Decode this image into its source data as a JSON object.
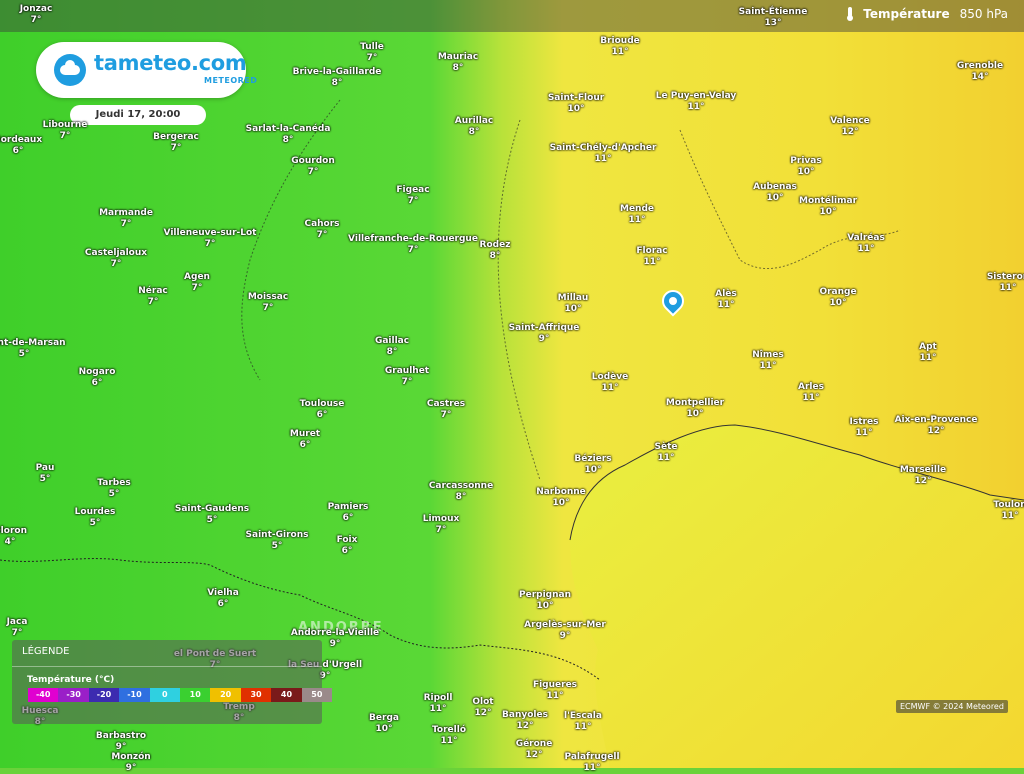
{
  "header": {
    "layer_name": "Température",
    "layer_level": "850 hPa",
    "thermometer_icon": "thermometer-icon"
  },
  "logo": {
    "name": "tameteo.com",
    "subname": "METEORED",
    "icon": "cloud-logo-icon"
  },
  "date_label": "Jeudi 17, 20:00",
  "regions": [
    "ANDORRE"
  ],
  "cities": [
    {
      "name": "Jonzac",
      "temp": "7°"
    },
    {
      "name": "Saint-Étienne",
      "temp": "13°"
    },
    {
      "name": "Brioude",
      "temp": "11°"
    },
    {
      "name": "Tulle",
      "temp": "7°"
    },
    {
      "name": "Mauriac",
      "temp": "8°"
    },
    {
      "name": "Brive-la-Gaillarde",
      "temp": "8°"
    },
    {
      "name": "Grenoble",
      "temp": "14°"
    },
    {
      "name": "Saint-Flour",
      "temp": "10°"
    },
    {
      "name": "Le Puy-en-Velay",
      "temp": "11°"
    },
    {
      "name": "Libourne",
      "temp": "7°"
    },
    {
      "name": "Bordeaux",
      "temp": "6°"
    },
    {
      "name": "Bergerac",
      "temp": "7°"
    },
    {
      "name": "Sarlat-la-Canéda",
      "temp": "8°"
    },
    {
      "name": "Aurillac",
      "temp": "8°"
    },
    {
      "name": "Valence",
      "temp": "12°"
    },
    {
      "name": "Saint-Chély-d'Apcher",
      "temp": "11°"
    },
    {
      "name": "Gourdon",
      "temp": "7°"
    },
    {
      "name": "Privas",
      "temp": "10°"
    },
    {
      "name": "Figeac",
      "temp": "7°"
    },
    {
      "name": "Aubenas",
      "temp": "10°"
    },
    {
      "name": "Montélimar",
      "temp": "10°"
    },
    {
      "name": "Marmande",
      "temp": "7°"
    },
    {
      "name": "Mende",
      "temp": "11°"
    },
    {
      "name": "Cahors",
      "temp": "7°"
    },
    {
      "name": "Villeneuve-sur-Lot",
      "temp": "7°"
    },
    {
      "name": "Villefranche-de-Rouergue",
      "temp": "7°"
    },
    {
      "name": "Rodez",
      "temp": "8°"
    },
    {
      "name": "Valréas",
      "temp": "11°"
    },
    {
      "name": "Casteljaloux",
      "temp": "7°"
    },
    {
      "name": "Florac",
      "temp": "11°"
    },
    {
      "name": "Agen",
      "temp": "7°"
    },
    {
      "name": "Sisteron",
      "temp": "11°"
    },
    {
      "name": "Nérac",
      "temp": "7°"
    },
    {
      "name": "Moissac",
      "temp": "7°"
    },
    {
      "name": "Millau",
      "temp": "10°"
    },
    {
      "name": "Alès",
      "temp": "11°"
    },
    {
      "name": "Orange",
      "temp": "10°"
    },
    {
      "name": "Mont-de-Marsan",
      "temp": "5°"
    },
    {
      "name": "Saint-Affrique",
      "temp": "9°"
    },
    {
      "name": "Gaillac",
      "temp": "8°"
    },
    {
      "name": "Apt",
      "temp": "11°"
    },
    {
      "name": "Nogaro",
      "temp": "6°"
    },
    {
      "name": "Graulhet",
      "temp": "7°"
    },
    {
      "name": "Nîmes",
      "temp": "11°"
    },
    {
      "name": "Lodève",
      "temp": "11°"
    },
    {
      "name": "Arles",
      "temp": "11°"
    },
    {
      "name": "Toulouse",
      "temp": "6°"
    },
    {
      "name": "Castres",
      "temp": "7°"
    },
    {
      "name": "Montpellier",
      "temp": "10°"
    },
    {
      "name": "Istres",
      "temp": "11°"
    },
    {
      "name": "Aix-en-Provence",
      "temp": "12°"
    },
    {
      "name": "Muret",
      "temp": "6°"
    },
    {
      "name": "Sète",
      "temp": "11°"
    },
    {
      "name": "Béziers",
      "temp": "10°"
    },
    {
      "name": "Pau",
      "temp": "5°"
    },
    {
      "name": "Marseille",
      "temp": "12°"
    },
    {
      "name": "Tarbes",
      "temp": "5°"
    },
    {
      "name": "Carcassonne",
      "temp": "8°"
    },
    {
      "name": "Narbonne",
      "temp": "10°"
    },
    {
      "name": "Pamiers",
      "temp": "6°"
    },
    {
      "name": "Lourdes",
      "temp": "5°"
    },
    {
      "name": "Saint-Gaudens",
      "temp": "5°"
    },
    {
      "name": "Limoux",
      "temp": "7°"
    },
    {
      "name": "Toulon",
      "temp": "11°"
    },
    {
      "name": "Oloron",
      "temp": "4°"
    },
    {
      "name": "Saint-Girons",
      "temp": "5°"
    },
    {
      "name": "Foix",
      "temp": "6°"
    },
    {
      "name": "Perpignan",
      "temp": "10°"
    },
    {
      "name": "Vielha",
      "temp": "6°"
    },
    {
      "name": "Jaca",
      "temp": "7°"
    },
    {
      "name": "Andorre-la-Vieille",
      "temp": "9°"
    },
    {
      "name": "Argelès-sur-Mer",
      "temp": "9°"
    },
    {
      "name": "el Pont de Suert",
      "temp": "7°"
    },
    {
      "name": "la Seu d'Urgell",
      "temp": "9°"
    },
    {
      "name": "Figueres",
      "temp": "11°"
    },
    {
      "name": "Huesca",
      "temp": "8°"
    },
    {
      "name": "Tremp",
      "temp": "8°"
    },
    {
      "name": "Ripoll",
      "temp": "11°"
    },
    {
      "name": "Olot",
      "temp": "12°"
    },
    {
      "name": "Berga",
      "temp": "10°"
    },
    {
      "name": "Banyoles",
      "temp": "12°"
    },
    {
      "name": "l'Escala",
      "temp": "11°"
    },
    {
      "name": "Barbastro",
      "temp": "9°"
    },
    {
      "name": "Torelló",
      "temp": "11°"
    },
    {
      "name": "Gérone",
      "temp": "12°"
    },
    {
      "name": "Monzón",
      "temp": "9°"
    },
    {
      "name": "Palafrugell",
      "temp": "11°"
    }
  ],
  "legend": {
    "title": "LÉGENDE",
    "subtitle": "Température (°C)",
    "scale": [
      {
        "label": "-40",
        "color": "#e000d0"
      },
      {
        "label": "-30",
        "color": "#9a1fc8"
      },
      {
        "label": "-20",
        "color": "#3c2bb0"
      },
      {
        "label": "-10",
        "color": "#2f6fe0"
      },
      {
        "label": "0",
        "color": "#2fd0e0"
      },
      {
        "label": "10",
        "color": "#3ad030"
      },
      {
        "label": "20",
        "color": "#f0c000"
      },
      {
        "label": "30",
        "color": "#e03000"
      },
      {
        "label": "40",
        "color": "#7a1a1a"
      },
      {
        "label": "50",
        "color": "#9a8a8a"
      }
    ]
  },
  "credit": "ECMWF © 2024 Meteored",
  "colors": {
    "cold": "#45d42e",
    "warm": "#f2e23a",
    "brand": "#1f9de0"
  }
}
